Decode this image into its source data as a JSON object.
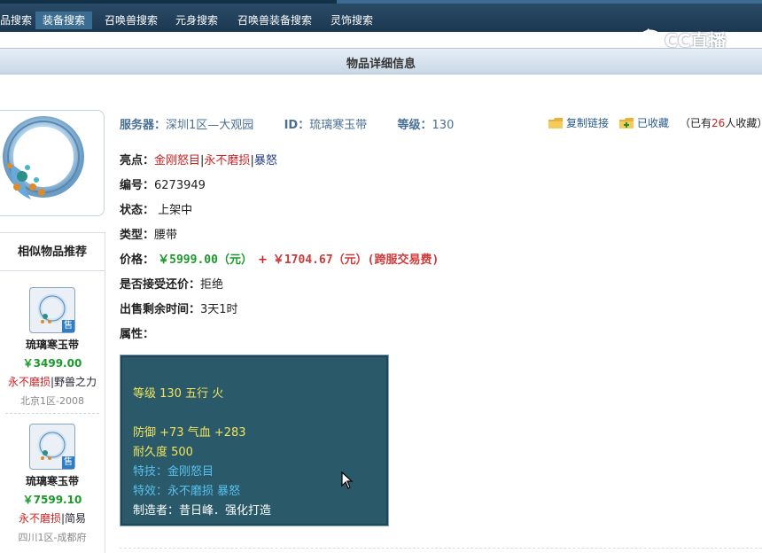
{
  "nav": {
    "tabs": [
      {
        "label": "品搜索",
        "active": false
      },
      {
        "label": "装备搜索",
        "active": true
      },
      {
        "label": "召唤兽搜索",
        "active": false
      },
      {
        "label": "元身搜索",
        "active": false
      },
      {
        "label": "召唤兽装备搜索",
        "active": false
      },
      {
        "label": "灵饰搜索",
        "active": false
      }
    ]
  },
  "logo": {
    "text": "CC直播",
    "icon": "cc-logo-icon"
  },
  "title": "物品详细信息",
  "item": {
    "server_label": "服务器：",
    "server": "深圳1区—大观园",
    "id_label": "ID：",
    "id": "琉璃寒玉带",
    "level_label": "等级：",
    "level": "130",
    "copy_link": "复制链接",
    "favorited": "已收藏",
    "fav_prefix": "（已有",
    "fav_count": "26",
    "fav_suffix": "人收藏）",
    "highlights_label": "亮点：",
    "highlights": [
      "金刚怒目",
      "永不磨损",
      "暴怒"
    ],
    "sep": "|",
    "number_label": "编号：",
    "number": "6273949",
    "status_label": "状态：",
    "status": "上架中",
    "type_label": "类型：",
    "type": "腰带",
    "price_label": "价格：",
    "price": "￥5999.00（元）",
    "plus": "+",
    "fee": "￥1704.67（元）(跨服交易费)",
    "counteroffer_label": "是否接受还价：",
    "counteroffer": "拒绝",
    "remaining_label": "出售剩余时间：",
    "remaining": "3天1时",
    "attrs_label": "属性："
  },
  "attributes": {
    "level_line": "等级 130  五行 火",
    "stats_line": "防御 +73  气血 +283",
    "durability_line": "耐久度 500",
    "skill_line": "特技：金刚怒目",
    "effect_line": "特效：永不磨损 暴怒",
    "maker_line": "制造者：昔日峰．强化打造"
  },
  "sidebar": {
    "title": "相似物品推荐",
    "items": [
      {
        "name": "琉璃寒玉带",
        "price": "￥3499.00",
        "hl1": "永不磨损",
        "sep": "|",
        "hl2": "野兽之力",
        "server": "北京1区-2008",
        "badge": "售"
      },
      {
        "name": "琉璃寒玉带",
        "price": "￥7599.10",
        "hl1": "永不磨损",
        "sep": "|",
        "hl2": "简易",
        "server": "四川1区-成都府",
        "badge": "售"
      }
    ]
  },
  "colors": {
    "nav_bg": "#1c3850",
    "price_green": "#1a9a2a",
    "highlight_red": "#cc2222",
    "attr_bg": "#2a5a6a"
  }
}
